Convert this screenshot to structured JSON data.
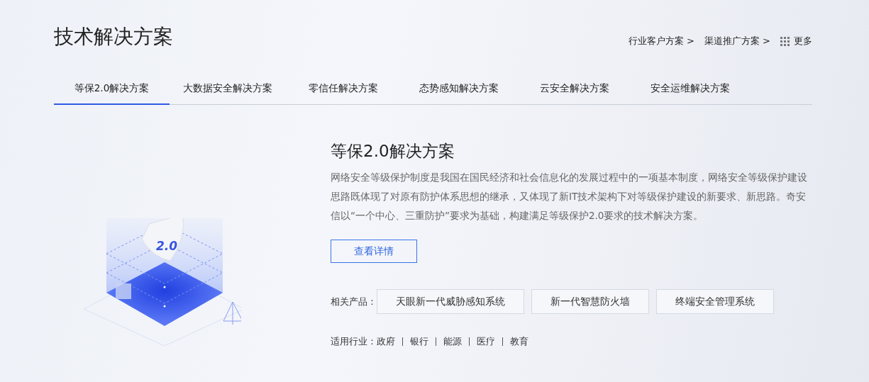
{
  "page_title": "技术解决方案",
  "header_links": [
    {
      "label": "行业客户方案 >",
      "kind": "link"
    },
    {
      "label": "渠道推广方案 >",
      "kind": "link"
    },
    {
      "label": "更多",
      "kind": "more"
    }
  ],
  "tabs": [
    {
      "label": "等保2.0解决方案",
      "selected": true
    },
    {
      "label": "大数据安全解决方案",
      "selected": false
    },
    {
      "label": "零信任解决方案",
      "selected": false
    },
    {
      "label": "态势感知解决方案",
      "selected": false
    },
    {
      "label": "云安全解决方案",
      "selected": false
    },
    {
      "label": "安全运维解决方案",
      "selected": false
    }
  ],
  "detail": {
    "illustration_label": "2.0",
    "title": "等保2.0解决方案",
    "description": "网络安全等级保护制度是我国在国民经济和社会信息化的发展过程中的一项基本制度，网络安全等级保护建设思路既体现了对原有防护体系思想的继承，又体现了新IT技术架构下对等级保护建设的新要求、新思路。奇安信以“一个中心、三重防护”要求为基础，构建满足等级保护2.0要求的技术解决方案。",
    "details_button": "查看详情",
    "products_label": "相关产品：",
    "products": [
      "天眼新一代威胁感知系统",
      "新一代智慧防火墙",
      "终端安全管理系统"
    ],
    "industries_label": "适用行业：",
    "industries": [
      "政府",
      "银行",
      "能源",
      "医疗",
      "教育"
    ]
  }
}
